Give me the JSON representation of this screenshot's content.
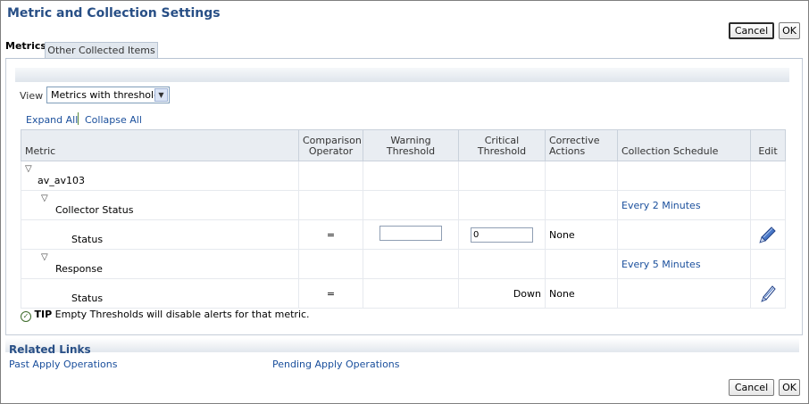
{
  "page": {
    "title": "Metric and Collection Settings"
  },
  "buttons": {
    "cancel": "Cancel",
    "ok": "OK"
  },
  "tabs": [
    {
      "label": "Metrics",
      "active": true
    },
    {
      "label": "Other Collected Items",
      "active": false
    }
  ],
  "view": {
    "label": "View",
    "selected": "Metrics with thresholds"
  },
  "actions": {
    "expand_all": "Expand All",
    "collapse_all": "Collapse All"
  },
  "table": {
    "headers": {
      "metric": "Metric",
      "comparison": "Comparison Operator",
      "warning": "Warning Threshold",
      "critical": "Critical Threshold",
      "corrective": "Corrective Actions",
      "schedule": "Collection Schedule",
      "edit": "Edit"
    },
    "rows": [
      {
        "name": "av_av103"
      },
      {
        "name": "Collector Status",
        "schedule": "Every 2 Minutes"
      },
      {
        "name": "Status",
        "operator": "=",
        "warning": "",
        "critical": "0",
        "corrective": "None"
      },
      {
        "name": "Response",
        "schedule": "Every 5 Minutes"
      },
      {
        "name": "Status",
        "operator": "=",
        "critical": "Down",
        "corrective": "None"
      }
    ]
  },
  "tip": {
    "label": "TIP",
    "text": "Empty Thresholds will disable alerts for that metric."
  },
  "related": {
    "title": "Related Links",
    "links": [
      "Past Apply Operations",
      "Pending Apply Operations"
    ]
  },
  "icons": {
    "tree_toggle": "expanded-triangle-icon",
    "edit": "pencil-icon",
    "tip": "checkmark-icon",
    "dropdown": "chevron-down-icon"
  },
  "colors": {
    "title": "#284f86",
    "link": "#1a4f9c",
    "header_bg": "#e9edf2"
  }
}
